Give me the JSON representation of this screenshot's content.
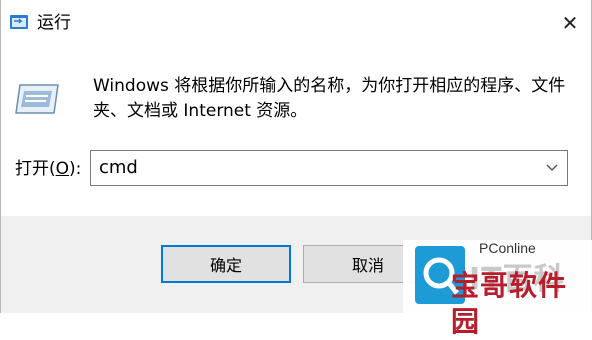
{
  "window": {
    "title": "运行",
    "close_label": "✕"
  },
  "dialog": {
    "description": "Windows 将根据你所输入的名称，为你打开相应的程序、文件夹、文档或 Internet 资源。",
    "open_label_prefix": "打开(",
    "open_label_accel": "O",
    "open_label_suffix": "):",
    "command_value": "cmd"
  },
  "buttons": {
    "ok": "确定",
    "cancel": "取消"
  },
  "watermark": {
    "brand": "PConline",
    "big_text": "IT百科",
    "stamp_text": "宝哥软件园"
  },
  "colors": {
    "accent": "#0078d7",
    "footer_bg": "#f0f0f0",
    "button_bg": "#e1e1e1"
  }
}
